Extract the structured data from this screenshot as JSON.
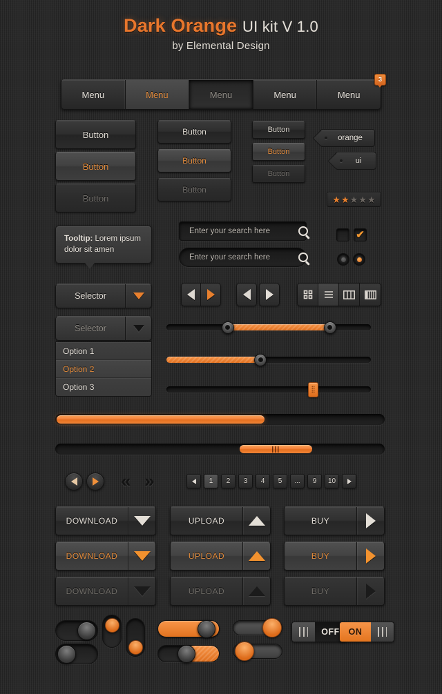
{
  "header": {
    "title_accent": "Dark Orange",
    "title_rest": "UI kit V 1.0",
    "subtitle": "by Elemental Design"
  },
  "colors": {
    "accent": "#e8762c",
    "accent_light": "#f79548",
    "background": "#2b2b2b",
    "text": "#ddd8d0",
    "text_dim": "#6d6a66"
  },
  "menubar": {
    "items": [
      {
        "label": "Menu",
        "state": "normal"
      },
      {
        "label": "Menu",
        "state": "active"
      },
      {
        "label": "Menu",
        "state": "pressed"
      },
      {
        "label": "Menu",
        "state": "normal"
      },
      {
        "label": "Menu",
        "state": "normal",
        "badge": "3"
      }
    ]
  },
  "buttons": {
    "large": [
      {
        "label": "Button",
        "state": "normal"
      },
      {
        "label": "Button",
        "state": "hover"
      },
      {
        "label": "Button",
        "state": "disabled"
      }
    ],
    "medium": [
      {
        "label": "Button",
        "state": "normal"
      },
      {
        "label": "Button",
        "state": "hover"
      },
      {
        "label": "Button",
        "state": "disabled"
      }
    ],
    "small": [
      {
        "label": "Button",
        "state": "normal"
      },
      {
        "label": "Button",
        "state": "hover"
      },
      {
        "label": "Button",
        "state": "disabled"
      }
    ]
  },
  "tags": [
    {
      "label": "orange"
    },
    {
      "label": "ui"
    }
  ],
  "rating": {
    "value": 2,
    "max": 5,
    "star_glyph": "★"
  },
  "tooltip": {
    "prefix": "Tooltip:",
    "text": " Lorem ipsum dolor sit amen"
  },
  "search": [
    {
      "placeholder": "Enter your search here",
      "value": "",
      "shape": "rect",
      "icon": "search-icon"
    },
    {
      "placeholder": "Enter your search here",
      "value": "",
      "shape": "pill",
      "icon": "search-icon"
    }
  ],
  "checkboxes": [
    {
      "checked": false
    },
    {
      "checked": true,
      "glyph": "✔"
    }
  ],
  "radios": [
    {
      "checked": false
    },
    {
      "checked": true
    }
  ],
  "selectors": [
    {
      "label": "Selector",
      "state": "normal",
      "arrow": "triangle-down-orange"
    },
    {
      "label": "Selector",
      "state": "open",
      "arrow": "triangle-down-dark"
    }
  ],
  "dropdown_options": [
    {
      "label": "Option 1",
      "selected": false
    },
    {
      "label": "Option 2",
      "selected": true
    },
    {
      "label": "Option 3",
      "selected": false
    }
  ],
  "viewbar": {
    "items": [
      {
        "icon": "grid-view-icon",
        "active": false
      },
      {
        "icon": "list-view-icon",
        "active": true
      },
      {
        "icon": "column-view-icon",
        "active": false
      },
      {
        "icon": "split-view-icon",
        "active": false
      }
    ]
  },
  "sliders": [
    {
      "type": "range",
      "low_percent": 30,
      "high_percent": 80
    },
    {
      "type": "single",
      "percent": 46
    },
    {
      "type": "grip",
      "percent": 72
    }
  ],
  "progress": {
    "percent": 63
  },
  "scrollbar": {
    "thumb_start_percent": 56,
    "thumb_width_percent": 22
  },
  "pagination": {
    "circle_prev": "prev-arrow",
    "circle_next": "next-arrow",
    "chevron_first": "«",
    "chevron_last": "»",
    "prev_label": "◀",
    "next_label": "▶",
    "pages": [
      {
        "label": "1",
        "current": true
      },
      {
        "label": "2",
        "current": false
      },
      {
        "label": "3",
        "current": false
      },
      {
        "label": "4",
        "current": false
      },
      {
        "label": "5",
        "current": false
      },
      {
        "label": "...",
        "current": false
      },
      {
        "label": "9",
        "current": false
      },
      {
        "label": "10",
        "current": false
      }
    ]
  },
  "actions": {
    "rows": [
      [
        {
          "label": "DOWNLOAD",
          "icon": "triangle-down-icon",
          "state": "normal"
        },
        {
          "label": "UPLOAD",
          "icon": "triangle-up-icon",
          "state": "normal"
        },
        {
          "label": "BUY",
          "icon": "triangle-right-icon",
          "state": "normal"
        }
      ],
      [
        {
          "label": "DOWNLOAD",
          "icon": "triangle-down-icon",
          "state": "hover"
        },
        {
          "label": "UPLOAD",
          "icon": "triangle-up-icon",
          "state": "hover"
        },
        {
          "label": "BUY",
          "icon": "triangle-right-icon",
          "state": "hover"
        }
      ],
      [
        {
          "label": "DOWNLOAD",
          "icon": "triangle-down-icon",
          "state": "disabled"
        },
        {
          "label": "UPLOAD",
          "icon": "triangle-up-icon",
          "state": "disabled"
        },
        {
          "label": "BUY",
          "icon": "triangle-right-icon",
          "state": "disabled"
        }
      ]
    ]
  },
  "toggles": {
    "labeled": [
      {
        "label": "OFF",
        "on": false
      },
      {
        "label": "ON",
        "on": true
      }
    ]
  }
}
